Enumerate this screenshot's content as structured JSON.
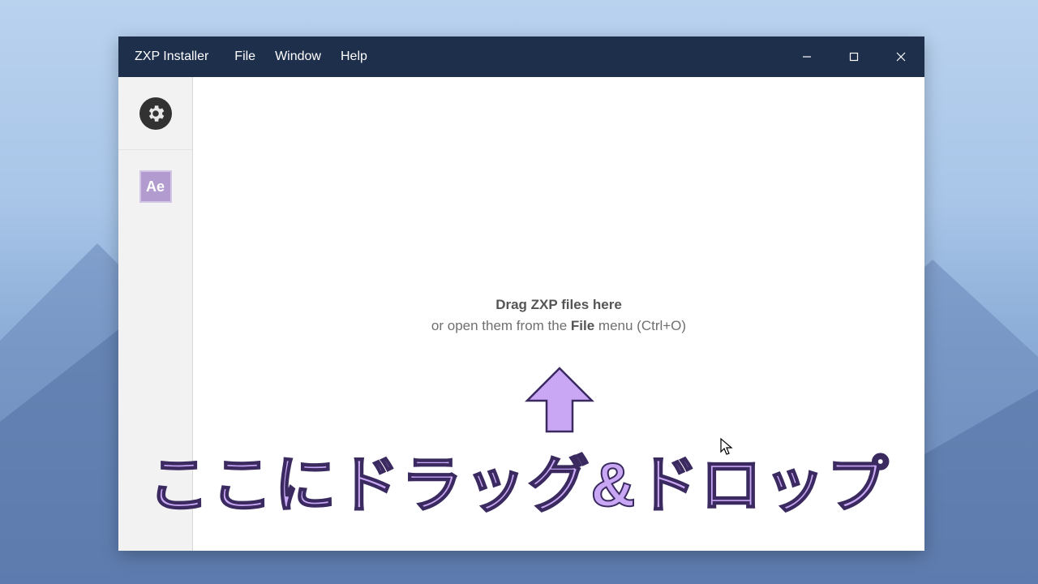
{
  "app": {
    "title": "ZXP Installer"
  },
  "menu": {
    "file": "File",
    "window": "Window",
    "help": "Help"
  },
  "sidebar": {
    "ae_label": "Ae"
  },
  "drop": {
    "line1": "Drag ZXP files here",
    "line2_pre": "or open them from the ",
    "line2_bold": "File",
    "line2_post": " menu (Ctrl+O)"
  },
  "annotation": {
    "jp_text": "ここにドラッグ&ドロップ"
  }
}
